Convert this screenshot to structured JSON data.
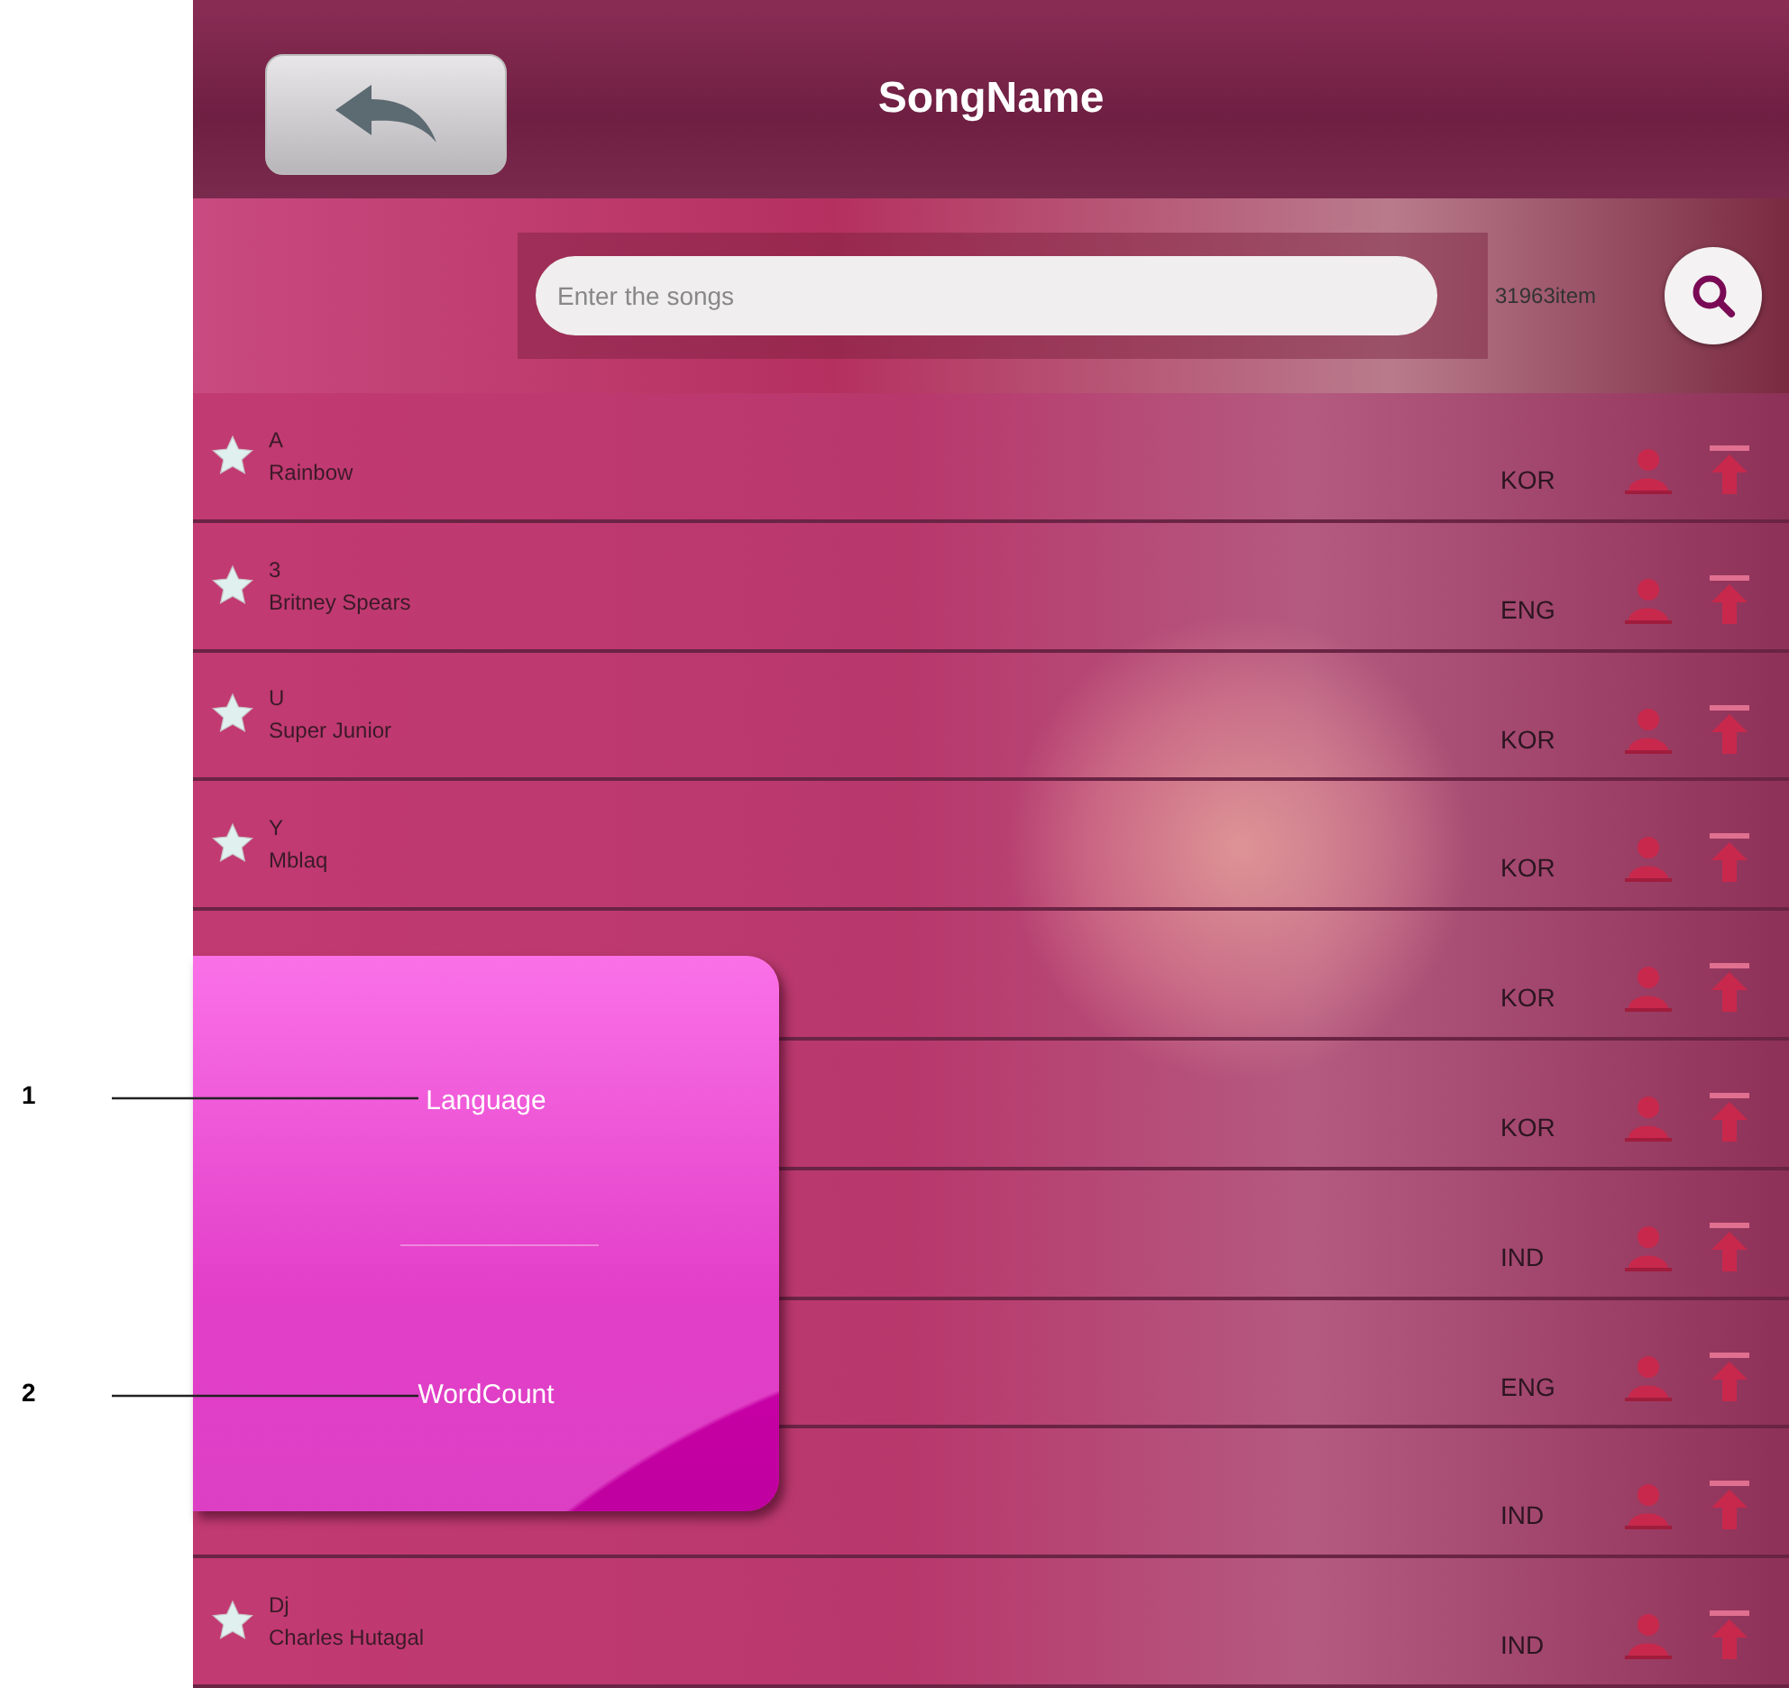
{
  "header": {
    "title": "SongName"
  },
  "search": {
    "placeholder": "Enter the songs",
    "count": "31963item"
  },
  "songs": [
    {
      "title": "A",
      "artist": "Rainbow",
      "language": "KOR"
    },
    {
      "title": "3",
      "artist": "Britney Spears",
      "language": "ENG"
    },
    {
      "title": "U",
      "artist": "Super Junior",
      "language": "KOR"
    },
    {
      "title": "Y",
      "artist": "Mblaq",
      "language": "KOR"
    },
    {
      "language": "KOR"
    },
    {
      "language": "KOR"
    },
    {
      "language": "IND"
    },
    {
      "language": "ENG"
    },
    {
      "language": "IND"
    },
    {
      "title": "Dj",
      "artist": "Charles Hutagal",
      "language": "IND"
    }
  ],
  "sort_menu": {
    "items": [
      {
        "label": "Language",
        "callout": "1"
      },
      {
        "label": "WordCount",
        "callout": "2"
      }
    ]
  }
}
